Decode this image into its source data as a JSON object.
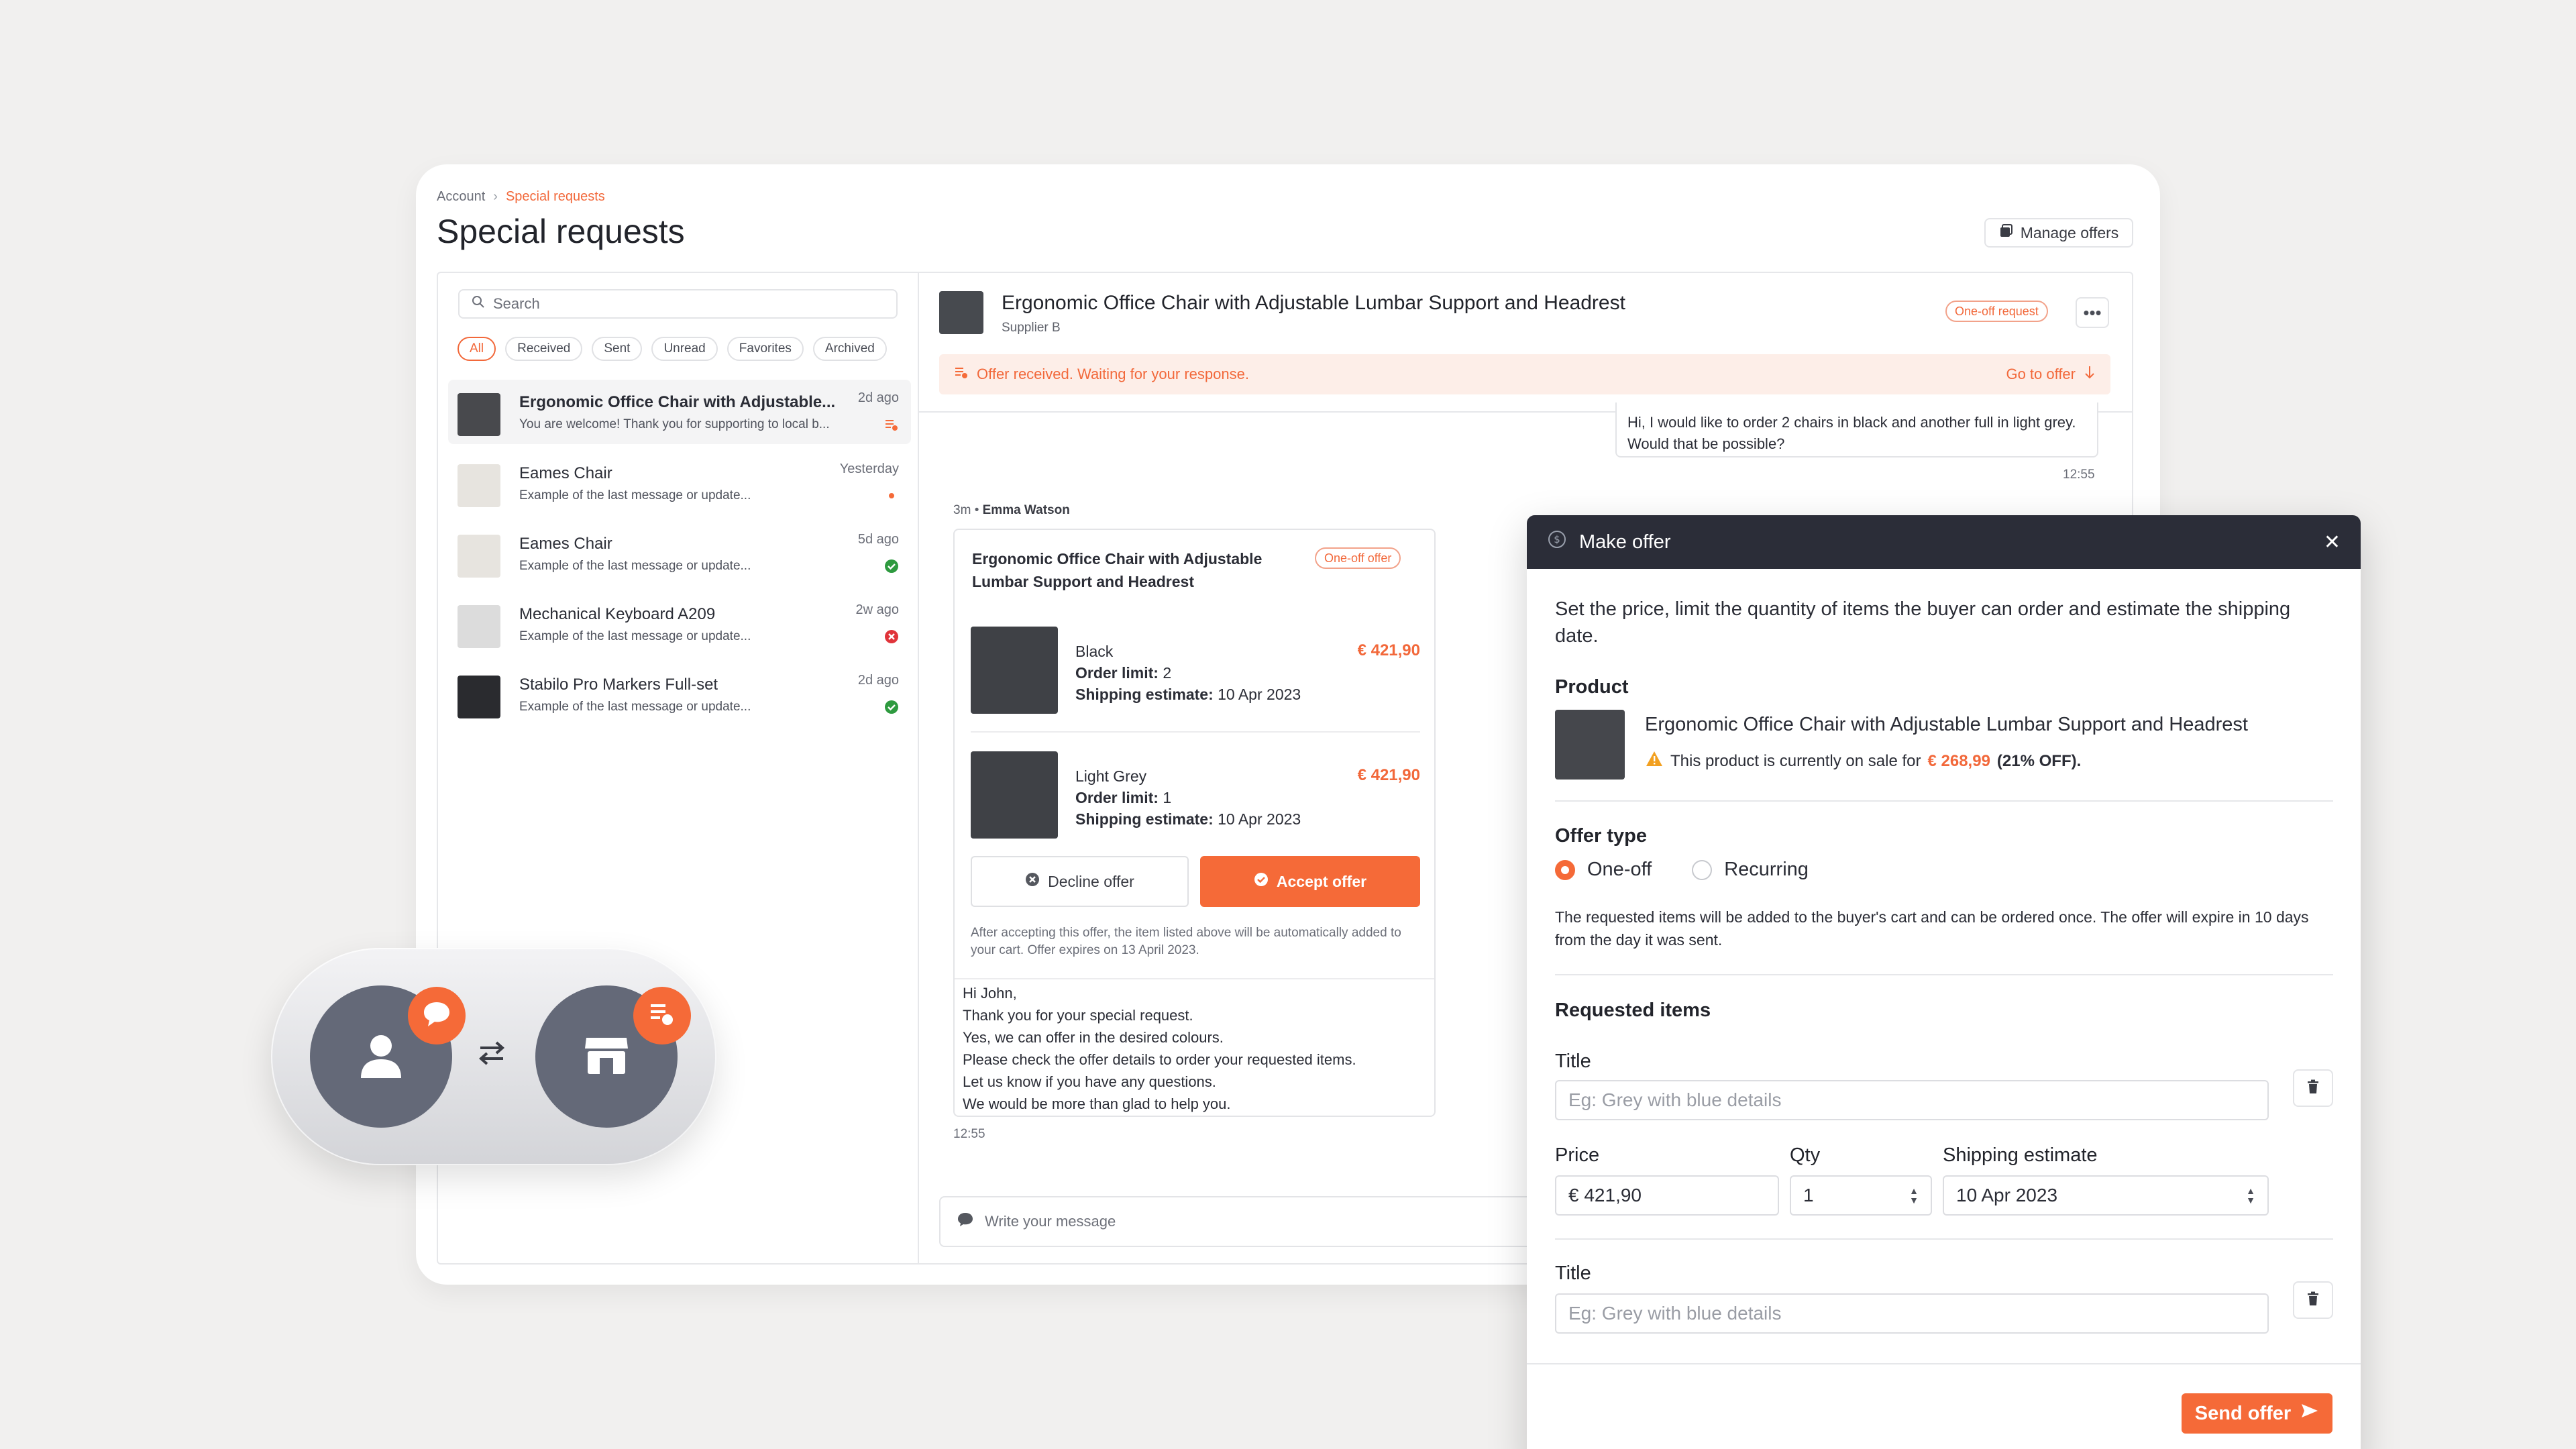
{
  "breadcrumb": {
    "parent": "Account",
    "separator": "›",
    "current": "Special requests"
  },
  "page_title": "Special requests",
  "manage_offers_label": "Manage offers",
  "search": {
    "placeholder": "Search"
  },
  "filters": [
    "All",
    "Received",
    "Sent",
    "Unread",
    "Favorites",
    "Archived"
  ],
  "conversations": [
    {
      "name": "Ergonomic Office Chair with Adjustable...",
      "last": "You are welcome! Thank you for supporting to local b...",
      "time": "2d ago"
    },
    {
      "name": "Eames Chair",
      "last": "Example of the last message or update...",
      "time": "Yesterday"
    },
    {
      "name": "Eames Chair",
      "last": "Example of the last message or update...",
      "time": "5d ago"
    },
    {
      "name": "Mechanical Keyboard A209",
      "last": "Example of the last message or update...",
      "time": "2w ago"
    },
    {
      "name": "Stabilo Pro Markers Full-set",
      "last": "Example of the last message or update...",
      "time": "2d ago"
    }
  ],
  "chat": {
    "title": "Ergonomic Office Chair with Adjustable Lumbar Support and Headrest",
    "supplier": "Supplier B",
    "badge": "One-off request",
    "more": "•••",
    "alert": "Offer received. Waiting for your response.",
    "goto": "Go to offer",
    "outgoing_text": "Hi, I would like to order 2 chairs in black and another full in light grey. Would that be possible?",
    "outgoing_time": "12:55",
    "meta_time": "3m",
    "meta_bullet": "•",
    "meta_sender": "Emma Watson",
    "incoming_time": "12:55",
    "composer_placeholder": "Write your message"
  },
  "offer": {
    "title": "Ergonomic Office Chair with Adjustable Lumbar Support and Headrest",
    "badge": "One-off offer",
    "items": [
      {
        "color": "Black",
        "limit_label": "Order limit:",
        "limit": "2",
        "ship_label": "Shipping estimate:",
        "ship": "10 Apr 2023",
        "price": "€ 421,90"
      },
      {
        "color": "Light Grey",
        "limit_label": "Order limit:",
        "limit": "1",
        "ship_label": "Shipping estimate:",
        "ship": "10 Apr 2023",
        "price": "€ 421,90"
      }
    ],
    "decline": "Decline offer",
    "accept": "Accept offer",
    "note": "After accepting this offer, the item listed above will be automatically added to your cart. Offer expires on 13 April 2023.",
    "message": [
      "Hi John,",
      "Thank you for your special request.",
      "Yes, we can offer in the desired colours.",
      "Please check the offer details to order your requested items.",
      "Let us know if you have any questions.",
      "We would be more than glad to help you."
    ]
  },
  "modal": {
    "title": "Make offer",
    "close": "✕",
    "intro": "Set the price, limit the quantity of items the buyer can order and estimate the shipping date.",
    "product_label": "Product",
    "product_name": "Ergonomic Office Chair with Adjustable Lumbar Support and Headrest",
    "sale_prefix": "This product is currently on sale for",
    "sale_price": "€ 268,99",
    "sale_off": "(21% OFF).",
    "offer_type_label": "Offer type",
    "offer_types": [
      "One-off",
      "Recurring"
    ],
    "offer_type_desc": "The requested items will be added to the buyer's cart and can be ordered once. The offer will expire in 10 days from the day it was sent.",
    "requested_label": "Requested items",
    "title_label": "Title",
    "title_placeholder": "Eg: Grey with blue details",
    "price_label": "Price",
    "price_value": "€ 421,90",
    "qty_label": "Qty",
    "qty_value": "1",
    "ship_label": "Shipping estimate",
    "ship_value": "10 Apr 2023",
    "send": "Send offer"
  },
  "colors": {
    "accent": "#f56a38",
    "dark": "#2b2d38",
    "success": "#2e9a3f",
    "error": "#e0343a"
  }
}
